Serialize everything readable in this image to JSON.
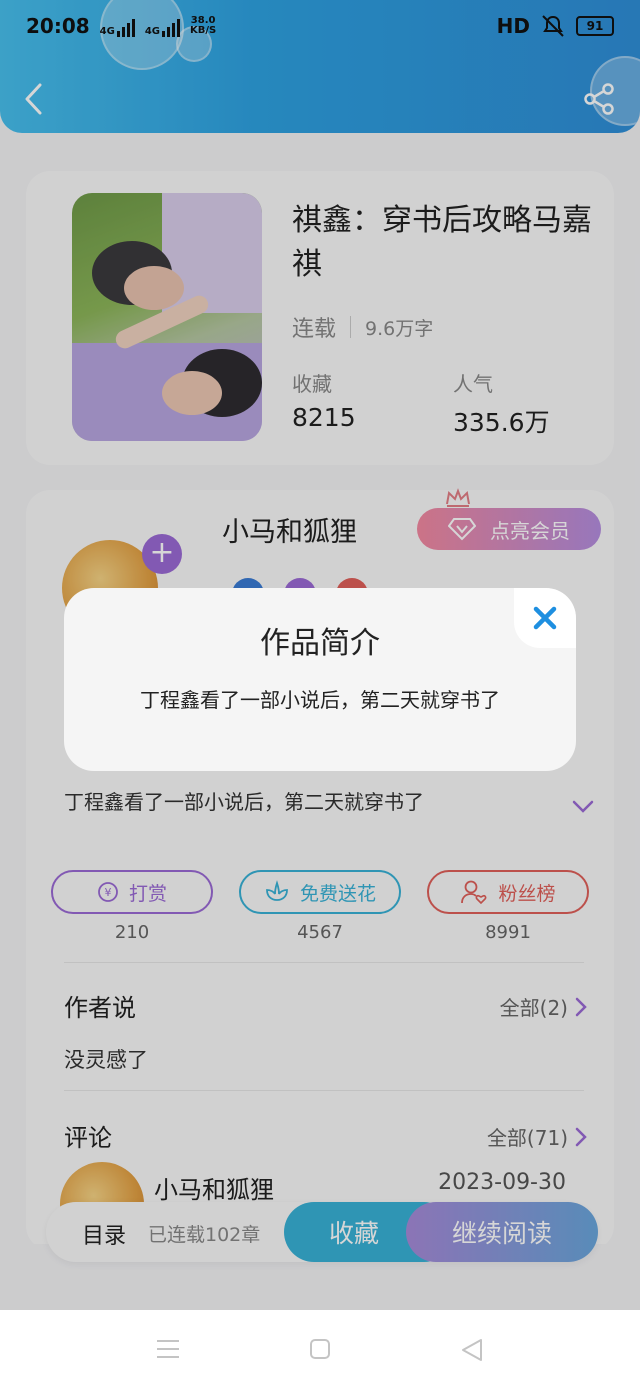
{
  "status_bar": {
    "time": "20:08",
    "net1": "4G",
    "net2": "4G",
    "speed_value": "38.0",
    "speed_unit": "KB/S",
    "hd": "HD",
    "battery": "91"
  },
  "book": {
    "title": "祺鑫：穿书后攻略马嘉祺",
    "status": "连载",
    "words": "9.6万字",
    "fav_label": "收藏",
    "fav_value": "8215",
    "pop_label": "人气",
    "pop_value": "335.6万"
  },
  "author": {
    "name": "小马和狐狸",
    "vip_label": "点亮会员",
    "plus": "+"
  },
  "intro": {
    "text": "丁程鑫看了一部小说后，第二天就穿书了"
  },
  "actions": [
    {
      "label": "打赏",
      "count": "210"
    },
    {
      "label": "免费送花",
      "count": "4567"
    },
    {
      "label": "粉丝榜",
      "count": "8991"
    }
  ],
  "author_says": {
    "title": "作者说",
    "more": "全部(2)",
    "text": "没灵感了"
  },
  "comments": {
    "title": "评论",
    "more": "全部(71)",
    "first_user": "小马和狐狸",
    "first_date": "2023-09-30"
  },
  "bottom_bar": {
    "toc": "目录",
    "chapters": "已连载102章",
    "favorite": "收藏",
    "continue": "继续阅读"
  },
  "modal": {
    "title": "作品简介",
    "body": "丁程鑫看了一部小说后，第二天就穿书了"
  },
  "colors": {
    "header": "#2fa6e4",
    "accent_purple": "#9b6bd6",
    "accent_teal": "#39b2d7",
    "accent_red": "#e0605a"
  }
}
